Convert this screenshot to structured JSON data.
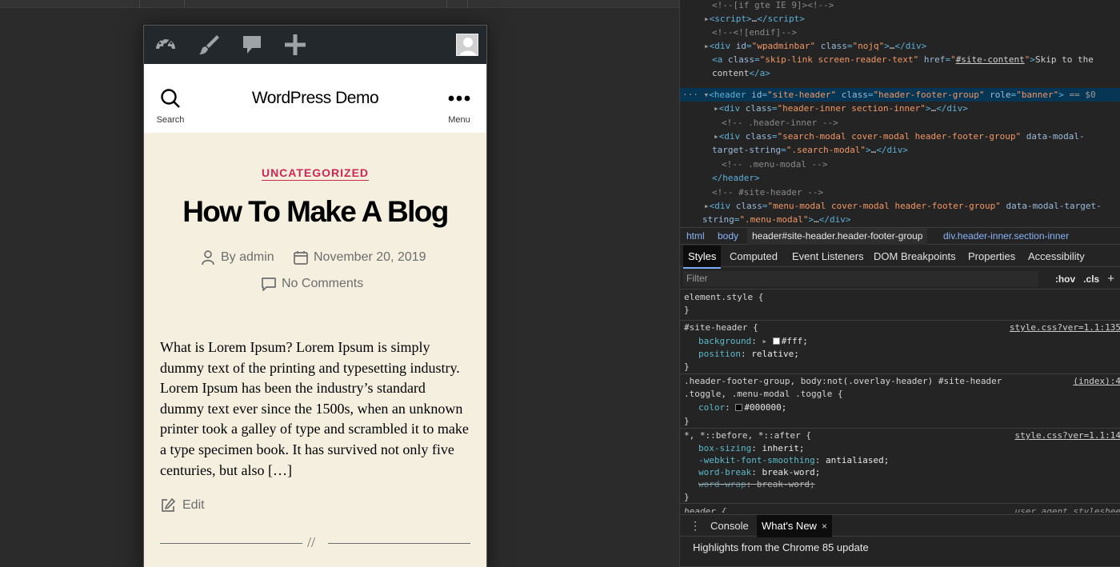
{
  "device_page": {
    "adminbar": {
      "icons": [
        "dashboard-icon",
        "customize-brush-icon",
        "comments-icon",
        "new-content-plus-icon"
      ],
      "avatar": "avatar-icon"
    },
    "header": {
      "site_title": "WordPress Demo",
      "search_label": "Search",
      "menu_label": "Menu"
    },
    "post": {
      "category": "UNCATEGORIZED",
      "title": "How To Make A Blog",
      "author": "By admin",
      "date": "November 20, 2019",
      "comments": "No Comments",
      "excerpt_lines": [
        "What is Lorem Ipsum? Lorem Ipsum is simply",
        "dummy text of the printing and typesetting industry.",
        "Lorem Ipsum has been the industry’s standard",
        "dummy text ever since the 1500s, when an unknown",
        "printer took a galley of type and scrambled it to make",
        "a type specimen book. It has survived not only five",
        "centuries, but also […]"
      ],
      "edit_label": "Edit",
      "separator": "//"
    },
    "colors": {
      "accent": "#cd2653",
      "background": "#f5efe0",
      "adminbar": "#23282d"
    }
  },
  "devtools": {
    "dom_lines": [
      {
        "html": "<span class='cmt'>&lt;!--[if gte IE 9]&gt;&lt;!--&gt;</span>"
      },
      {
        "html": "<span class='tri'>▸</span><span class='tag'>&lt;script&gt;</span><span class='txt'>…</span><span class='tag'>&lt;/script&gt;</span>"
      },
      {
        "html": "<span class='cmt'>&lt;!--&lt;![endif]--&gt;</span>"
      },
      {
        "html": "<span class='tri'>▸</span><span class='tag'>&lt;div </span><span class='attr'>id</span><span class='tag'>=</span><span class='aval'>\"wpadminbar\"</span><span class='attr'> class</span><span class='tag'>=</span><span class='aval'>\"nojq\"</span><span class='tag'>&gt;</span><span class='txt'>…</span><span class='tag'>&lt;/div&gt;</span>"
      },
      {
        "html": "<span class='tag'>&lt;a </span><span class='attr'>class</span><span class='tag'>=</span><span class='aval'>\"skip-link screen-reader-text\"</span><span class='attr'> href</span><span class='tag'>=</span><span class='aval'>\"<span class='link'>#site-content</span>\"</span><span class='tag'>&gt;</span><span class='txt'>Skip to the</span>"
      },
      {
        "html": "<span class='txt'>content</span><span class='tag'>&lt;/a&gt;</span>"
      },
      {
        "html": "<span class='tri'>▾</span><span class='tag'>&lt;header </span><span class='attr'>id</span><span class='tag'>=</span><span class='aval'>\"site-header\"</span><span class='attr'> class</span><span class='tag'>=</span><span class='aval'>\"header-footer-group\"</span><span class='attr'> role</span><span class='tag'>=</span><span class='aval'>\"banner\"</span><span class='tag'>&gt;</span><span class='sel-marker'> == $0</span>"
      },
      {
        "html": "<span class='tri'>▸</span><span class='tag'>&lt;div </span><span class='attr'>class</span><span class='tag'>=</span><span class='aval'>\"header-inner section-inner\"</span><span class='tag'>&gt;</span><span class='txt'>…</span><span class='tag'>&lt;/div&gt;</span>"
      },
      {
        "html": "<span class='cmt'>&lt;!-- .header-inner --&gt;</span>"
      },
      {
        "html": "<span class='tri'>▸</span><span class='tag'>&lt;div </span><span class='attr'>class</span><span class='tag'>=</span><span class='aval'>\"search-modal cover-modal header-footer-group\"</span><span class='attr'> data-modal-</span>"
      },
      {
        "html": "<span class='attr'>target-string</span><span class='tag'>=</span><span class='aval'>\".search-modal\"</span><span class='tag'>&gt;</span><span class='txt'>…</span><span class='tag'>&lt;/div&gt;</span>"
      },
      {
        "html": "<span class='cmt'>&lt;!-- .menu-modal --&gt;</span>"
      },
      {
        "html": "<span class='tag'>&lt;/header&gt;</span>"
      },
      {
        "html": "<span class='cmt'>&lt;!-- #site-header --&gt;</span>"
      },
      {
        "html": "<span class='tri'>▸</span><span class='tag'>&lt;div </span><span class='attr'>class</span><span class='tag'>=</span><span class='aval'>\"menu-modal cover-modal header-footer-group\"</span><span class='attr'> data-modal-target-</span>"
      },
      {
        "html": "<span class='attr'>string</span><span class='tag'>=</span><span class='aval'>\".menu-modal\"</span><span class='tag'>&gt;</span><span class='txt'>…</span><span class='tag'>&lt;/div&gt;</span>"
      }
    ],
    "breadcrumbs": [
      "html",
      "body",
      "header#site-header.header-footer-group",
      "div.header-inner.section-inner"
    ],
    "tabs": [
      "Styles",
      "Computed",
      "Event Listeners",
      "DOM Breakpoints",
      "Properties",
      "Accessibility"
    ],
    "filter": {
      "placeholder": "Filter",
      "hov": ":hov",
      "cls": ".cls",
      "plus": "+"
    },
    "rules": {
      "r1_sel": "element.style {",
      "close": "}",
      "r2_sel": "#site-header {",
      "r2_src": "style.css?ver=1.1:135",
      "r2_p1_name": "background",
      "r2_p1_val": "#fff;",
      "r2_p2_name": "position",
      "r2_p2_val": "relative;",
      "r3_sel1": ".header-footer-group, body:not(.overlay-header) #site-header",
      "r3_sel2": ".toggle, .menu-modal .toggle {",
      "r3_src": "(index):4",
      "r3_p1_name": "color",
      "r3_p1_val": "#000000;",
      "r4_sel": "*, *::before, *::after {",
      "r4_src": "style.css?ver=1.1:14",
      "r4_p1_name": "box-sizing",
      "r4_p1_val": "inherit;",
      "r4_p2_name": "-webkit-font-smoothing",
      "r4_p2_val": "antialiased;",
      "r4_p3_name": "word-break",
      "r4_p3_val": "break-word;",
      "r4_p4_name": "word-wrap",
      "r4_p4_val": "break-word;",
      "r5_sel": "header {",
      "r5_src": "user agent styleshee"
    },
    "drawer": {
      "tabs": [
        "Console",
        "What's New"
      ],
      "close": "×",
      "message": "Highlights from the Chrome 85 update"
    }
  }
}
